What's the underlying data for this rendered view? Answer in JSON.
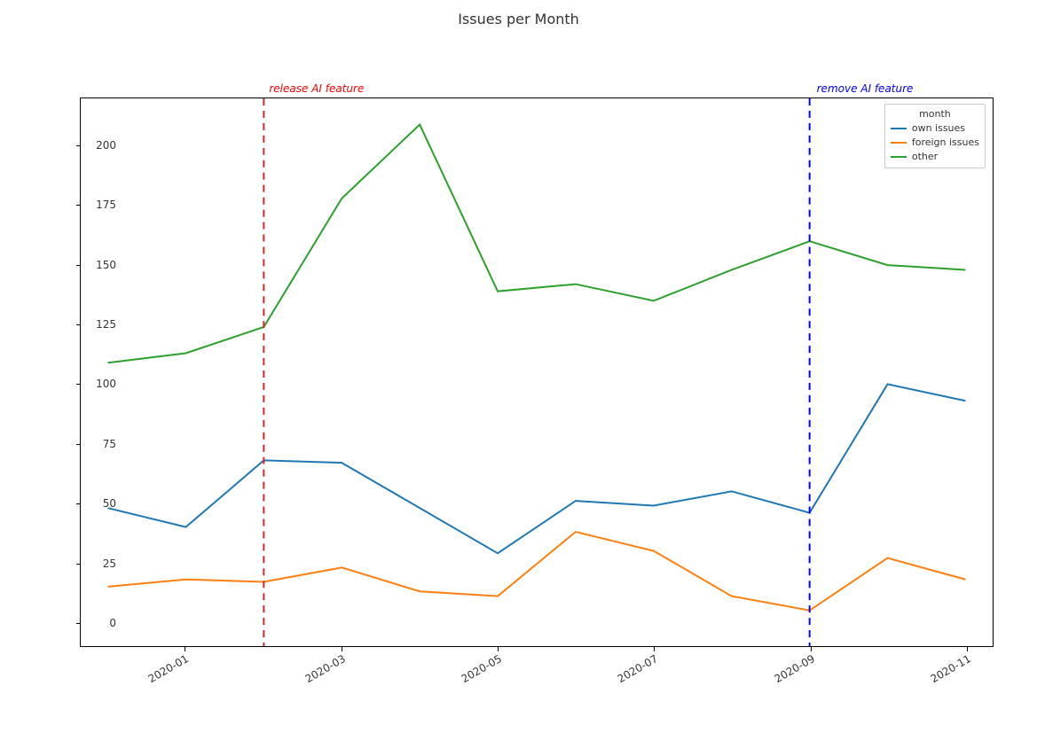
{
  "title": "Issues per Month",
  "chart_data": {
    "type": "line",
    "x": [
      "2019-12",
      "2020-01",
      "2020-02",
      "2020-03",
      "2020-04",
      "2020-05",
      "2020-06",
      "2020-07",
      "2020-08",
      "2020-09",
      "2020-10",
      "2020-11"
    ],
    "xticks_shown": [
      "2020-01",
      "2020-03",
      "2020-05",
      "2020-07",
      "2020-09",
      "2020-11"
    ],
    "legend_title": "month",
    "series": [
      {
        "name": "own issues",
        "color": "#1f77b4",
        "values": [
          48,
          40,
          68,
          67,
          48,
          29,
          51,
          49,
          55,
          46,
          100,
          93
        ]
      },
      {
        "name": "foreign issues",
        "color": "#ff7f0e",
        "values": [
          15,
          18,
          17,
          23,
          13,
          11,
          38,
          30,
          11,
          5,
          27,
          18
        ]
      },
      {
        "name": "other",
        "color": "#2ca02c",
        "values": [
          109,
          113,
          124,
          178,
          209,
          139,
          142,
          135,
          148,
          160,
          150,
          148
        ]
      }
    ],
    "yticks": [
      0,
      25,
      50,
      75,
      100,
      125,
      150,
      175,
      200
    ],
    "ylim": [
      -10,
      220
    ],
    "annotations": [
      {
        "text": "release AI feature",
        "x_index": 2,
        "color": "red",
        "line_color": "#d62728"
      },
      {
        "text": "remove AI feature",
        "x_index": 9,
        "color": "blue",
        "line_color": "#0000ff"
      }
    ]
  }
}
